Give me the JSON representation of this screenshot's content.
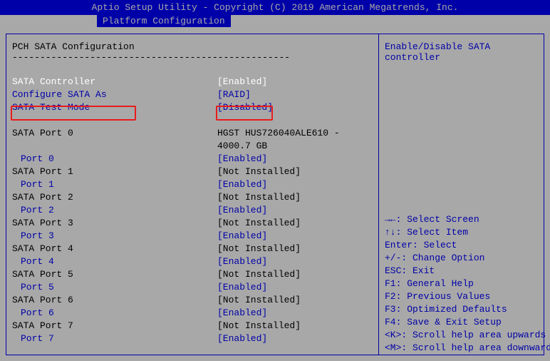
{
  "header": {
    "title": "Aptio Setup Utility - Copyright (C) 2019 American Megatrends, Inc.",
    "active_tab": "Platform Configuration"
  },
  "section": {
    "title": "PCH SATA Configuration",
    "divider": "--------------------------------------------------"
  },
  "items": [
    {
      "label": "SATA Controller",
      "value": "[Enabled]",
      "style": "white",
      "interact": true
    },
    {
      "label": "Configure SATA As",
      "value": "[RAID]",
      "style": "blue",
      "interact": true
    },
    {
      "label": "SATA Test Mode",
      "value": "[Disabled]",
      "style": "blue",
      "interact": true
    }
  ],
  "ports": [
    {
      "hdr_label": "SATA Port 0",
      "hdr_value": "HGST HUS726040ALE610 -",
      "hdr_value2": "4000.7 GB",
      "sub_label": "Port 0",
      "sub_value": "[Enabled]"
    },
    {
      "hdr_label": "SATA Port 1",
      "hdr_value": "[Not Installed]",
      "sub_label": "Port 1",
      "sub_value": "[Enabled]"
    },
    {
      "hdr_label": "SATA Port 2",
      "hdr_value": "[Not Installed]",
      "sub_label": "Port 2",
      "sub_value": "[Enabled]"
    },
    {
      "hdr_label": "SATA Port 3",
      "hdr_value": "[Not Installed]",
      "sub_label": "Port 3",
      "sub_value": "[Enabled]"
    },
    {
      "hdr_label": "SATA Port 4",
      "hdr_value": "[Not Installed]",
      "sub_label": "Port 4",
      "sub_value": "[Enabled]"
    },
    {
      "hdr_label": "SATA Port 5",
      "hdr_value": "[Not Installed]",
      "sub_label": "Port 5",
      "sub_value": "[Enabled]"
    },
    {
      "hdr_label": "SATA Port 6",
      "hdr_value": "[Not Installed]",
      "sub_label": "Port 6",
      "sub_value": "[Enabled]"
    },
    {
      "hdr_label": "SATA Port 7",
      "hdr_value": "[Not Installed]",
      "sub_label": "Port 7",
      "sub_value": "[Enabled]"
    }
  ],
  "help": "Enable/Disable SATA controller",
  "legend": {
    "l0": "→←: Select Screen",
    "l1": "↑↓: Select Item",
    "l2": "Enter: Select",
    "l3": "+/-: Change Option",
    "l4": "ESC: Exit",
    "l5": "F1: General Help",
    "l6": "F2: Previous Values",
    "l7": "F3: Optimized Defaults",
    "l8": "F4: Save & Exit Setup",
    "l9": "<K>: Scroll help area upwards",
    "l10": "<M>: Scroll help area downwards"
  }
}
